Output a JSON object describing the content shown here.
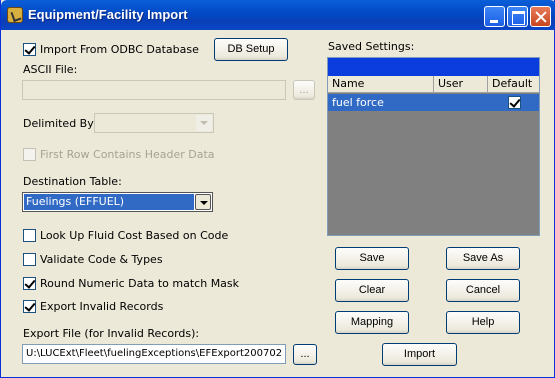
{
  "window": {
    "title": "Equipment/Facility Import"
  },
  "odbc": {
    "label": "Import From ODBC Database",
    "checked": true,
    "db_setup_label": "DB Setup"
  },
  "ascii": {
    "label": "ASCII File:",
    "value": "",
    "browse_label": "..."
  },
  "delimited": {
    "label": "Delimited By:",
    "value": ""
  },
  "first_row": {
    "label": "First Row Contains Header Data",
    "checked": false
  },
  "destination": {
    "label": "Destination Table:",
    "value": "Fuelings (EFFUEL)"
  },
  "options": [
    {
      "label": "Look Up Fluid Cost Based on Code",
      "checked": false
    },
    {
      "label": "Validate Code & Types",
      "checked": false
    },
    {
      "label": "Round Numeric Data to match Mask",
      "checked": true
    },
    {
      "label": "Export Invalid Records",
      "checked": true
    }
  ],
  "export_file": {
    "label": "Export File (for Invalid Records):",
    "value": "U:\\LUCExt\\Fleet\\fuelingExceptions\\EFExport200702",
    "browse_label": "..."
  },
  "saved_settings": {
    "label": "Saved Settings:",
    "columns": [
      "Name",
      "User",
      "Default"
    ],
    "rows": [
      {
        "name": "fuel force",
        "user": "",
        "default": true
      }
    ]
  },
  "buttons": {
    "save": "Save",
    "save_as": "Save As",
    "clear": "Clear",
    "cancel": "Cancel",
    "mapping": "Mapping",
    "help": "Help",
    "import": "Import"
  }
}
